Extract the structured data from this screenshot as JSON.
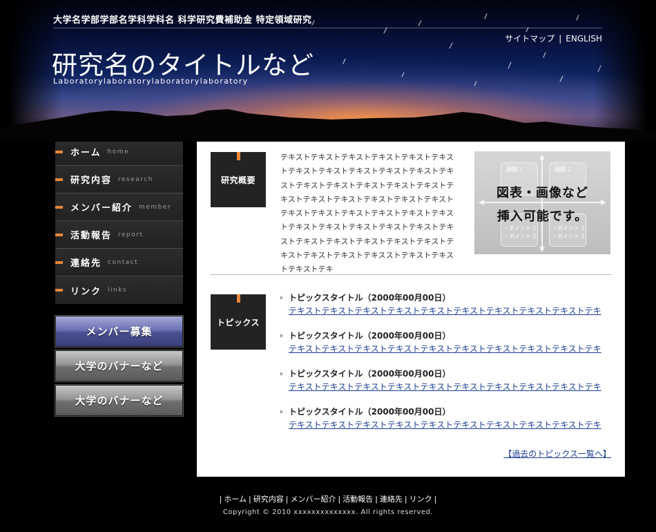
{
  "header": {
    "university": "大学名学部学部名学科学科名 科学研究費補助金 特定領域研究",
    "title": "研究名のタイトルなど",
    "subtitle": "Laboratorylaboratorylaboratorylaboratory",
    "links": {
      "sitemap": "サイトマップ",
      "separator": "|",
      "english": "ENGLISH"
    }
  },
  "nav": {
    "items": [
      {
        "jp": "ホーム",
        "en": "home"
      },
      {
        "jp": "研究内容",
        "en": "research"
      },
      {
        "jp": "メンバー紹介",
        "en": "member"
      },
      {
        "jp": "活動報告",
        "en": "report"
      },
      {
        "jp": "連絡先",
        "en": "contact"
      },
      {
        "jp": "リンク",
        "en": "links"
      }
    ]
  },
  "banners": {
    "member": "メンバー募集",
    "univ1": "大学のバナーなど",
    "univ2": "大学のバナーなど"
  },
  "overview": {
    "label": "研究概要",
    "text": "テキストテキストテキストテキストテキストテキストテキストテキストテキストテキストテキストテキストテキストテキストテキストテキストテキストテキストテキストテキストテキストテキストテキストテキストテキストテキストテキストテキストテキストテキストテキストテキストテキストテキストテキストテキストテキストテキストテキストテキストテキストテキストテキストテキスストテキストテキストテキストテキ",
    "figure": {
      "caption1": "図表・画像など",
      "caption2": "挿入可能です。",
      "task1": "課題 1",
      "task2": "課題 2",
      "point1": "・ポイント 1",
      "point2": "・ポイント 2"
    }
  },
  "topics": {
    "label": "トピックス",
    "items": [
      {
        "title": "トピックスタイトル（2000年00月00日）",
        "link": "テキストテキストテキストテキストテキストテキストテキストテキストテキストテキ"
      },
      {
        "title": "トピックスタイトル（2000年00月00日）",
        "link": "テキストテキストテキストテキストテキストテキストテキストテキストテキストテキ"
      },
      {
        "title": "トピックスタイトル（2000年00月00日）",
        "link": "テキストテキストテキストテキストテキストテキストテキストテキストテキストテキ"
      },
      {
        "title": "トピックスタイトル（2000年00月00日）",
        "link": "テキストテキストテキストテキストテキストテキストテキストテキストテキストテキ"
      }
    ],
    "more": "【過去のトピックス一覧へ】"
  },
  "footer": {
    "links": [
      "ホーム",
      "研究内容",
      "メンバー紹介",
      "活動報告",
      "連絡先",
      "リンク"
    ],
    "separator": "|",
    "copyright": "Copyright © 2010 xxxxxxxxxxxxxx. All rights reserved."
  },
  "colors": {
    "accent": "#e8873a",
    "link": "#1a3d8f",
    "panel": "#ffffff",
    "nav_bg": "#262626"
  }
}
